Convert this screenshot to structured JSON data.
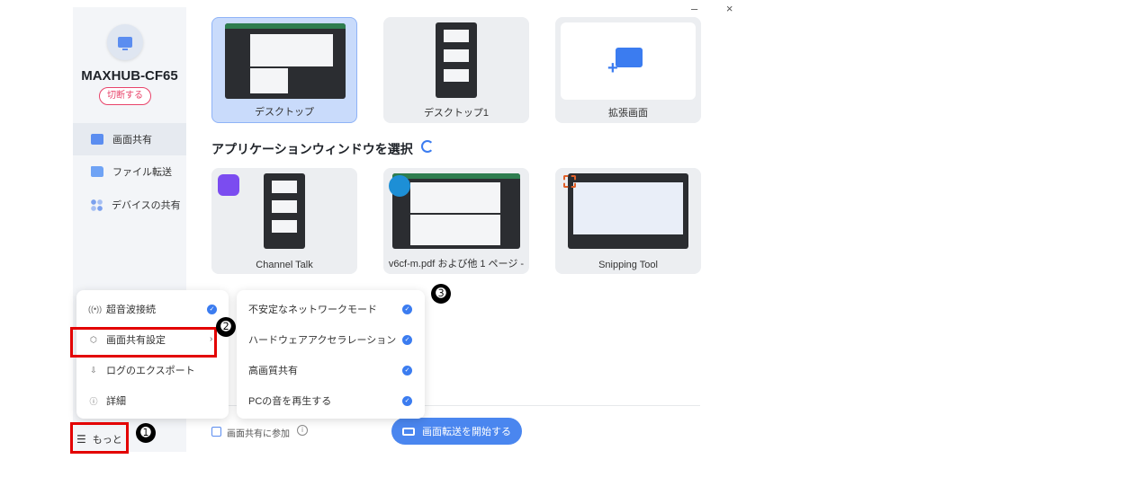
{
  "window": {
    "controls": "– ×"
  },
  "sidebar": {
    "device_name": "MAXHUB-CF65",
    "disconnect_label": "切断する",
    "nav": [
      {
        "label": "画面共有",
        "icon": "monitor-icon"
      },
      {
        "label": "ファイル転送",
        "icon": "folder-icon"
      },
      {
        "label": "デバイスの共有",
        "icon": "apps-icon"
      }
    ],
    "more_label": "もっと"
  },
  "screens": [
    {
      "label": "デスクトップ",
      "selected": true
    },
    {
      "label": "デスクトップ1",
      "selected": false
    },
    {
      "label": "拡張画面",
      "selected": false
    }
  ],
  "apps_section": {
    "title": "アプリケーションウィンドウを選択",
    "apps": [
      {
        "label": "Channel Talk",
        "icon": "channel-talk-icon"
      },
      {
        "label": "v6cf-m.pdf および他 1 ページ -",
        "icon": "edge-icon"
      },
      {
        "label": "Snipping Tool",
        "icon": "snipping-tool-icon"
      }
    ]
  },
  "more_menu": {
    "items": [
      {
        "label": "超音波接続",
        "icon": "ultrasonic-icon",
        "checked": true
      },
      {
        "label": "画面共有設定",
        "icon": "settings-icon",
        "has_submenu": true
      },
      {
        "label": "ログのエクスポート",
        "icon": "export-icon"
      },
      {
        "label": "詳細",
        "icon": "info-icon"
      }
    ]
  },
  "settings_submenu": {
    "items": [
      {
        "label": "不安定なネットワークモード",
        "checked": true
      },
      {
        "label": "ハードウェアアクセラレーション",
        "checked": true
      },
      {
        "label": "高画質共有",
        "checked": true
      },
      {
        "label": "PCの音を再生する",
        "checked": true
      }
    ]
  },
  "footer": {
    "join_label": "画面共有に参加",
    "start_label": "画面転送を開始する"
  },
  "annotations": {
    "badge1": "➊",
    "badge2": "➋",
    "badge3": "➌"
  },
  "colors": {
    "accent": "#3b7cf0",
    "danger": "#e8436a",
    "highlight": "#e30000"
  }
}
